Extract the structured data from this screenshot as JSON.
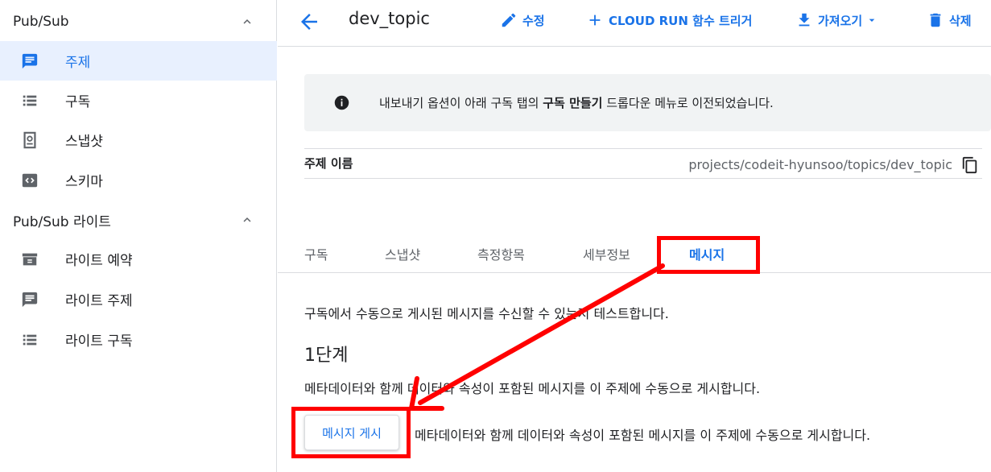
{
  "sidebar": {
    "sections": [
      {
        "title": "Pub/Sub",
        "items": [
          {
            "label": "주제",
            "icon": "topic-icon",
            "active": true
          },
          {
            "label": "구독",
            "icon": "list-icon",
            "active": false
          },
          {
            "label": "스냅샷",
            "icon": "snapshot-icon",
            "active": false
          },
          {
            "label": "스키마",
            "icon": "schema-icon",
            "active": false
          }
        ]
      },
      {
        "title": "Pub/Sub 라이트",
        "items": [
          {
            "label": "라이트 예약",
            "icon": "reservation-icon",
            "active": false
          },
          {
            "label": "라이트 주제",
            "icon": "topic-icon",
            "active": false
          },
          {
            "label": "라이트 구독",
            "icon": "list-icon",
            "active": false
          }
        ]
      }
    ]
  },
  "header": {
    "title": "dev_topic",
    "actions": {
      "edit": "수정",
      "trigger": "CLOUD RUN 함수 트리거",
      "import": "가져오기",
      "delete": "삭제"
    }
  },
  "banner": {
    "text_before": "내보내기 옵션이 아래 구독 탭의 ",
    "text_bold": "구독 만들기",
    "text_after": " 드롭다운 메뉴로 이전되었습니다."
  },
  "details": {
    "label": "주제 이름",
    "value": "projects/codeit-hyunsoo/topics/dev_topic"
  },
  "tabs": [
    "구독",
    "스냅샷",
    "측정항목",
    "세부정보",
    "메시지"
  ],
  "active_tab": "메시지",
  "messages": {
    "description": "구독에서 수동으로 게시된 메시지를 수신할 수 있는지 테스트합니다.",
    "step_title": "1단계",
    "step_description": "메타데이터와 함께 데이터와 속성이 포함된 메시지를 이 주제에 수동으로 게시합니다.",
    "publish_button": "메시지 게시",
    "publish_note": "메타데이터와 함께 데이터와 속성이 포함된 메시지를 이 주제에 수동으로 게시합니다."
  },
  "colors": {
    "accent": "#1a73e8",
    "active_bg": "#e8f0fe",
    "annotation": "#ff0000",
    "banner_bg": "#f1f3f4"
  }
}
